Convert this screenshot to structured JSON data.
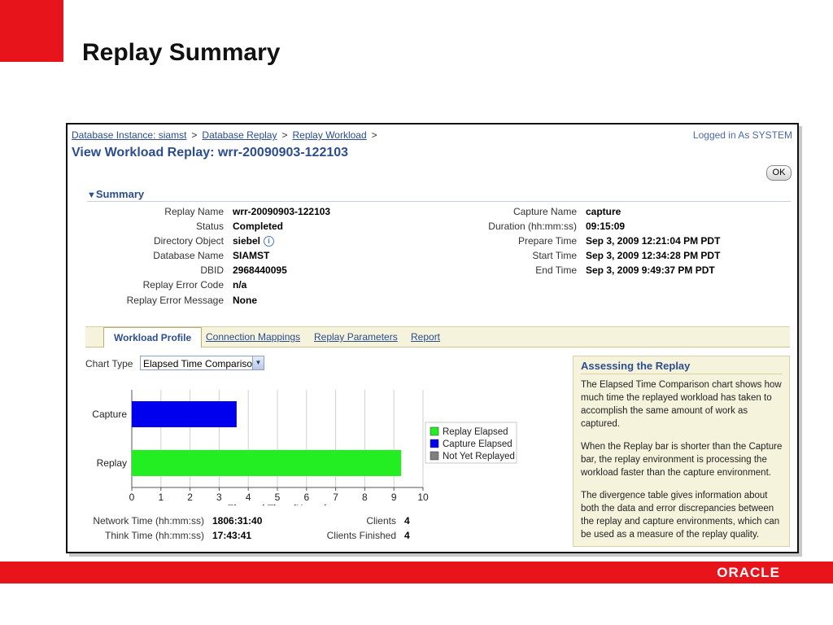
{
  "slide": {
    "title": "Replay Summary",
    "footer_brand": "ORACLE"
  },
  "breadcrumb": {
    "items": [
      "Database Instance: siamst",
      "Database Replay",
      "Replay Workload"
    ],
    "separator": ">"
  },
  "login_text": "Logged in As SYSTEM",
  "page_title": "View Workload Replay: wrr-20090903-122103",
  "ok_label": "OK",
  "summary": {
    "heading": "Summary",
    "left": [
      {
        "label": "Replay Name",
        "value": "wrr-20090903-122103"
      },
      {
        "label": "Status",
        "value": "Completed"
      },
      {
        "label": "Directory Object",
        "value": "siebel"
      },
      {
        "label": "Database Name",
        "value": "SIAMST"
      },
      {
        "label": "DBID",
        "value": "2968440095"
      },
      {
        "label": "Replay Error Code",
        "value": "n/a"
      },
      {
        "label": "Replay Error Message",
        "value": "None"
      }
    ],
    "right": [
      {
        "label": "Capture Name",
        "value": "capture"
      },
      {
        "label": "Duration (hh:mm:ss)",
        "value": "09:15:09"
      },
      {
        "label": "Prepare Time",
        "value": "Sep 3, 2009 12:21:04 PM PDT"
      },
      {
        "label": "Start Time",
        "value": "Sep 3, 2009 12:34:28 PM PDT"
      },
      {
        "label": "End Time",
        "value": "Sep 3, 2009 9:49:37 PM PDT"
      }
    ]
  },
  "tabs": [
    {
      "label": "Workload Profile",
      "active": true
    },
    {
      "label": "Connection Mappings"
    },
    {
      "label": "Replay Parameters"
    },
    {
      "label": "Report"
    }
  ],
  "chart_type": {
    "label": "Chart Type",
    "selected": "Elapsed Time Comparison"
  },
  "chart_data": {
    "type": "bar",
    "orientation": "horizontal",
    "categories": [
      "Capture",
      "Replay"
    ],
    "values": [
      3.6,
      9.25
    ],
    "bar_colors": [
      "#0000ee",
      "#22ee22"
    ],
    "xlabel": "Elapsed Time (Hours)",
    "xlim": [
      0,
      10
    ],
    "xticks": [
      "0",
      "1",
      "2",
      "3",
      "4",
      "5",
      "6",
      "7",
      "8",
      "9",
      "10"
    ],
    "grid": true,
    "legend_position": "right",
    "legend": [
      {
        "name": "Replay Elapsed",
        "color": "#22ee22"
      },
      {
        "name": "Capture Elapsed",
        "color": "#0000ee"
      },
      {
        "name": "Not Yet Replayed",
        "color": "#808080"
      }
    ]
  },
  "stats": [
    {
      "label": "Network Time (hh:mm:ss)",
      "value": "1806:31:40"
    },
    {
      "label": "Think Time (hh:mm:ss)",
      "value": "17:43:41"
    },
    {
      "label": "Clients",
      "value": "4"
    },
    {
      "label": "Clients Finished",
      "value": "4"
    }
  ],
  "assess": {
    "title": "Assessing the Replay",
    "p1": "The Elapsed Time Comparison chart shows how much time the replayed workload has taken to accomplish the same amount of work as captured.",
    "p2": "When the Replay bar is shorter than the Capture bar, the replay environment is processing the workload faster than the capture environment.",
    "p3": "The divergence table gives information about both the data and error discrepancies between the replay and capture environments, which can be used as a measure of the replay quality."
  }
}
